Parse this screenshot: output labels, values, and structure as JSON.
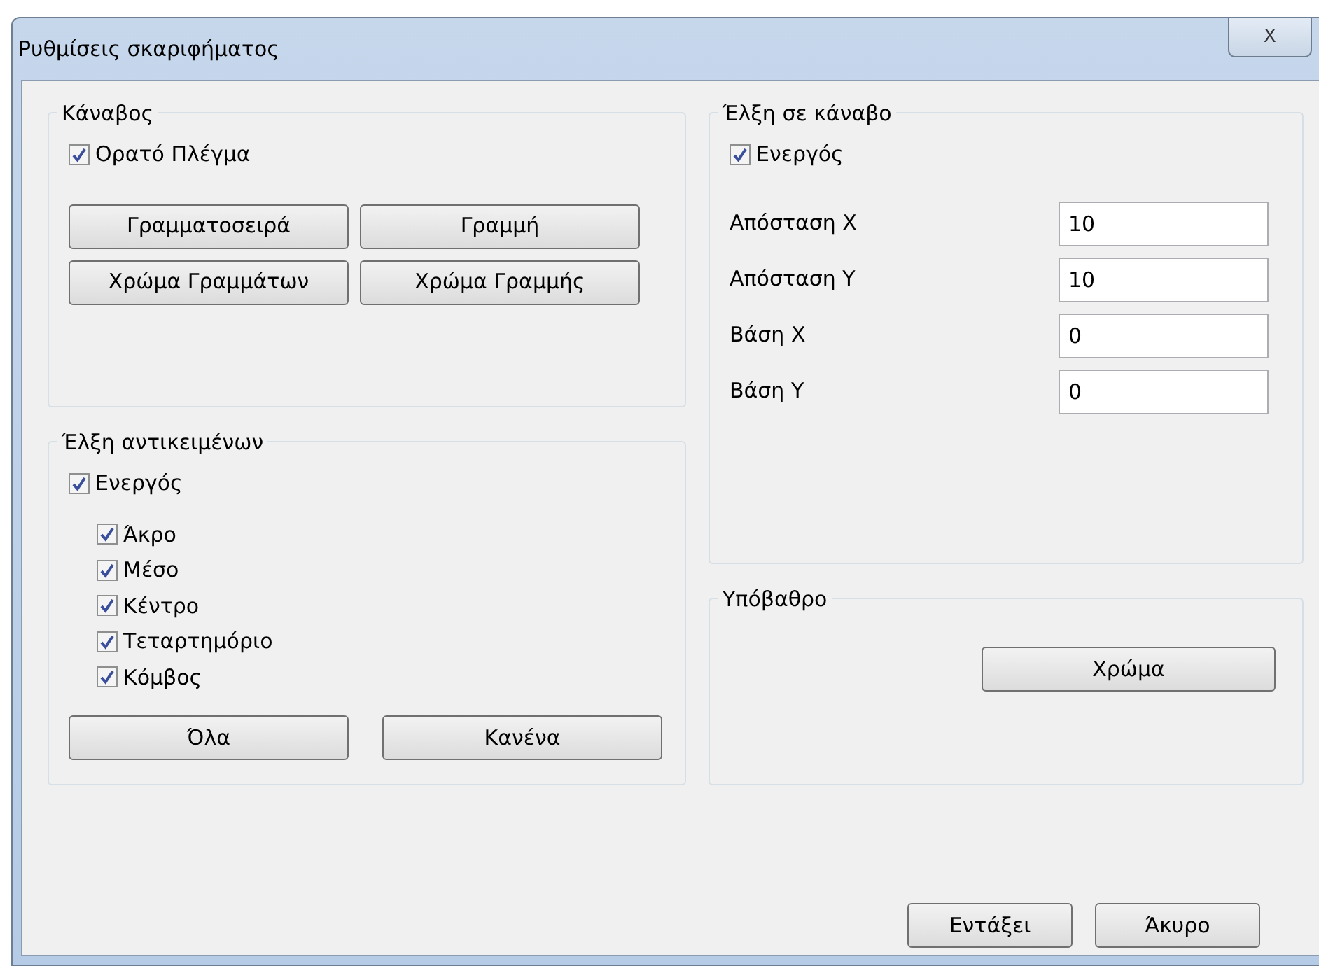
{
  "window": {
    "title": "Ρυθμίσεις σκαριφήματος",
    "close": "X"
  },
  "grid": {
    "title": "Κάναβος",
    "visible": {
      "label": "Ορατό Πλέγμα",
      "checked": true
    },
    "buttons": [
      "Γραμματοσειρά",
      "Γραμμή",
      "Χρώμα Γραμμάτων",
      "Χρώμα Γραμμής"
    ]
  },
  "object_snap": {
    "title": "Έλξη αντικειμένων",
    "enabled": {
      "label": "Ενεργός",
      "checked": true
    },
    "options": [
      {
        "label": "Άκρο",
        "checked": true
      },
      {
        "label": "Μέσο",
        "checked": true
      },
      {
        "label": "Κέντρο",
        "checked": true
      },
      {
        "label": "Τεταρτημόριο",
        "checked": true
      },
      {
        "label": "Κόμβος",
        "checked": true
      }
    ],
    "buttons": [
      "Όλα",
      "Κανένα"
    ]
  },
  "grid_snap": {
    "title": "Έλξη σε κάναβο",
    "enabled": {
      "label": "Ενεργός",
      "checked": true
    },
    "fields": [
      {
        "label": "Απόσταση X",
        "value": "10"
      },
      {
        "label": "Απόσταση Y",
        "value": "10"
      },
      {
        "label": "Βάση X",
        "value": "0"
      },
      {
        "label": "Βάση Y",
        "value": "0"
      }
    ]
  },
  "background": {
    "title": "Υπόβαθρο",
    "button": "Χρώμα"
  },
  "buttons": [
    "Εντάξει",
    "Άκυρο"
  ]
}
